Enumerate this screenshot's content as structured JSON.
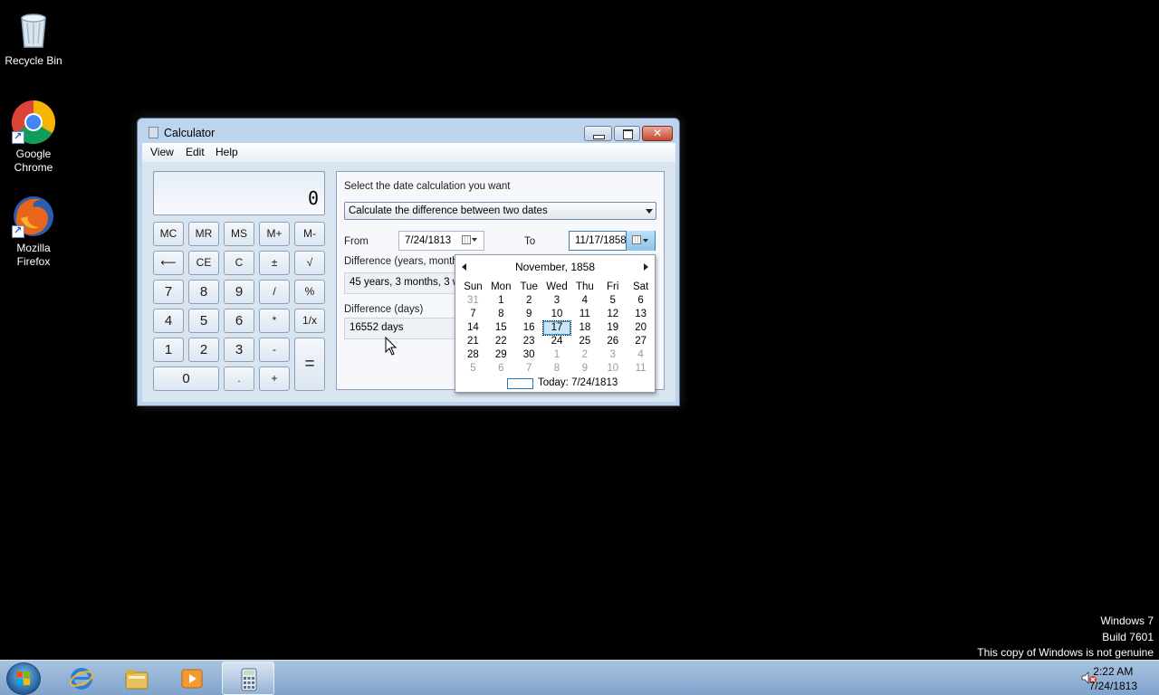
{
  "desktop": {
    "icons": [
      {
        "label_line1": "Recycle Bin",
        "label_line2": ""
      },
      {
        "label_line1": "Google",
        "label_line2": "Chrome"
      },
      {
        "label_line1": "Mozilla",
        "label_line2": "Firefox"
      }
    ],
    "watermark": {
      "line1": "Windows 7",
      "line2": "Build 7601",
      "line3": "This copy of Windows is not genuine"
    }
  },
  "calculator": {
    "title": "Calculator",
    "menu": [
      "View",
      "Edit",
      "Help"
    ],
    "display_value": "0",
    "keys": {
      "mc": "MC",
      "mr": "MR",
      "ms": "MS",
      "mplus": "M+",
      "mminus": "M-",
      "back": "⟵",
      "ce": "CE",
      "c": "C",
      "plusminus": "±",
      "sqrt": "√",
      "n7": "7",
      "n8": "8",
      "n9": "9",
      "div": "/",
      "pct": "%",
      "n4": "4",
      "n5": "5",
      "n6": "6",
      "mul": "*",
      "recip": "1/x",
      "n1": "1",
      "n2": "2",
      "n3": "3",
      "sub": "-",
      "eq": "=",
      "n0": "0",
      "dot": ".",
      "add": "+"
    },
    "date_panel": {
      "heading": "Select the date calculation you want",
      "mode": "Calculate the difference between two dates",
      "from_label": "From",
      "from_value": "7/24/1813",
      "to_label": "To",
      "to_value": "11/17/1858",
      "diff_label": "Difference (years, months",
      "diff_value": "45 years, 3 months, 3 w",
      "days_label": "Difference (days)",
      "days_value": "16552 days"
    },
    "calendar": {
      "month_year": "November, 1858",
      "dow": [
        "Sun",
        "Mon",
        "Tue",
        "Wed",
        "Thu",
        "Fri",
        "Sat"
      ],
      "weeks": [
        [
          "31",
          "1",
          "2",
          "3",
          "4",
          "5",
          "6"
        ],
        [
          "7",
          "8",
          "9",
          "10",
          "11",
          "12",
          "13"
        ],
        [
          "14",
          "15",
          "16",
          "17",
          "18",
          "19",
          "20"
        ],
        [
          "21",
          "22",
          "23",
          "24",
          "25",
          "26",
          "27"
        ],
        [
          "28",
          "29",
          "30",
          "1",
          "2",
          "3",
          "4"
        ],
        [
          "5",
          "6",
          "7",
          "8",
          "9",
          "10",
          "11"
        ]
      ],
      "selected_day": "17",
      "today_text": "Today: 7/24/1813"
    }
  },
  "taskbar": {
    "clock_time": "2:22 AM",
    "clock_date": "7/24/1813"
  },
  "colors": {
    "window_frame": "#bcd4ee",
    "taskbar": "#8fb0d6",
    "selected_day": "#cce4f7"
  }
}
